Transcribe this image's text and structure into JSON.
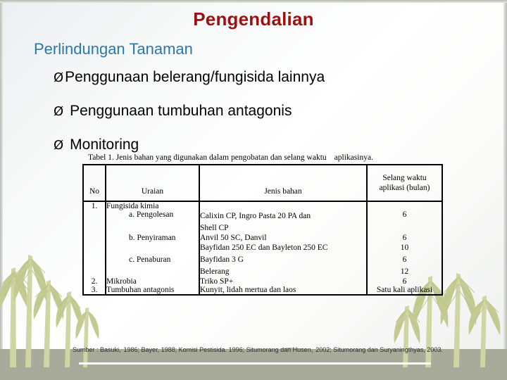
{
  "slide": {
    "title": "Pengendalian",
    "subtitle": "Perlindungan Tanaman",
    "title_color": "#9e1111",
    "subtitle_color": "#2b78a8",
    "bullets": [
      {
        "marker": "Ø",
        "text": "Penggunaan belerang/fungisida lainnya"
      },
      {
        "marker": "Ø",
        "text": "Penggunaan tumbuhan antagonis"
      },
      {
        "marker": "Ø",
        "text": "Monitoring"
      }
    ]
  },
  "table": {
    "caption_part1": "Tabel 1.  Jenis bahan yang digunakan dalam pengobatan dan selang waktu",
    "caption_part2": "aplikasinya.",
    "headers": {
      "no": "No",
      "uraian": "Uraian",
      "jenis_bahan": "Jenis bahan",
      "selang_line1": "Selang waktu",
      "selang_line2": "aplikasi (bulan)"
    },
    "rows": [
      {
        "no": "1.",
        "uraian": "Fungisida kimia",
        "jenis_bahan": "",
        "selang": ""
      },
      {
        "no": "",
        "uraian": "a.  Pengolesan",
        "jenis_bahan_line1": "Calixin CP,  Ingro Pasta 20 PA  dan",
        "jenis_bahan_line2": "Shell CP",
        "selang": "6"
      },
      {
        "no": "",
        "uraian": "b.  Penyiraman",
        "jenis_bahan": "Anvil 50 SC, Danvil",
        "selang": "6"
      },
      {
        "no": "",
        "uraian": "c.  Penaburan",
        "jenis_bahan_line1": "Bayfidan 250 EC dan Bayleton 250 EC",
        "jenis_bahan_line2": "Bayfidan 3 G",
        "jenis_bahan_line3": "Belerang",
        "selang_line1": "10",
        "selang_line2": "6",
        "selang_line3": "12"
      },
      {
        "no": "2.",
        "uraian": "Mikrobia",
        "jenis_bahan": "Triko SP+",
        "selang": "6"
      },
      {
        "no": "3.",
        "uraian": "Tumbuhan antagonis",
        "jenis_bahan": "Kunyit, lidah mertua dan laos",
        "selang": "Satu kali aplikasi"
      }
    ]
  },
  "source": {
    "label": "Sumber : Basuki,",
    "ref1": "1986; Bayer, 1988; Komisi Pestisida. 1996; Situmorang dan Husen,",
    "ref2": "2002; Situmorang dan Suryaningthyas, 2003."
  }
}
